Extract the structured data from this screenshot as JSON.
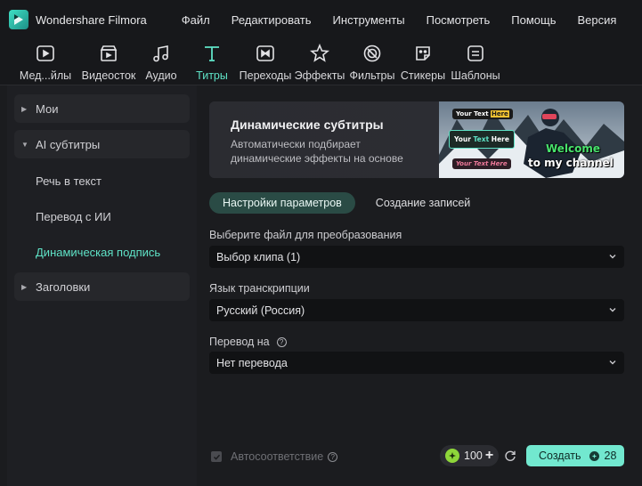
{
  "app": {
    "title": "Wondershare Filmora"
  },
  "menu": [
    "Файл",
    "Редактировать",
    "Инструменты",
    "Посмотреть",
    "Помощь",
    "Версия"
  ],
  "tools": [
    {
      "label": "Мед...йлы",
      "icon": "media-icon"
    },
    {
      "label": "Видеосток",
      "icon": "stock-video-icon"
    },
    {
      "label": "Аудио",
      "icon": "audio-icon"
    },
    {
      "label": "Титры",
      "icon": "titles-icon",
      "active": true
    },
    {
      "label": "Переходы",
      "icon": "transitions-icon"
    },
    {
      "label": "Эффекты",
      "icon": "effects-icon"
    },
    {
      "label": "Фильтры",
      "icon": "filters-icon"
    },
    {
      "label": "Стикеры",
      "icon": "stickers-icon"
    },
    {
      "label": "Шаблоны",
      "icon": "templates-icon"
    }
  ],
  "sidebar": {
    "mine": "Мои",
    "ai_subtitles": "AI субтитры",
    "speech_to_text": "Речь в текст",
    "ai_translate": "Перевод с ИИ",
    "dynamic_caption": "Динамическая подпись",
    "headings": "Заголовки"
  },
  "banner": {
    "title": "Динамические субтитры",
    "description": "Автоматически подбирает динамические эффекты на основе",
    "chip1_a": "Your Text ",
    "chip1_b": "Here",
    "chip2_a": "Your ",
    "chip2_b": "Text",
    "chip2_c": " Here",
    "chip3": "Your Text Here",
    "welcome": "Welcome",
    "channel": "to my channel"
  },
  "tabs": {
    "params": "Настройки параметров",
    "records": "Создание записей"
  },
  "form": {
    "file_label": "Выберите файл для преобразования",
    "file_value": "Выбор клипа (1)",
    "lang_label": "Язык транскрипции",
    "lang_value": "Русский (Россия)",
    "translate_label": "Перевод на",
    "translate_value": "Нет перевода",
    "help_glyph": "?"
  },
  "footer": {
    "auto_match": "Автосоответствие",
    "credits": "100",
    "plus": "+",
    "create": "Создать",
    "cost": "28"
  },
  "colors": {
    "accent": "#5fe3c7",
    "button": "#72e8cf",
    "coin": "#8ed63a"
  }
}
